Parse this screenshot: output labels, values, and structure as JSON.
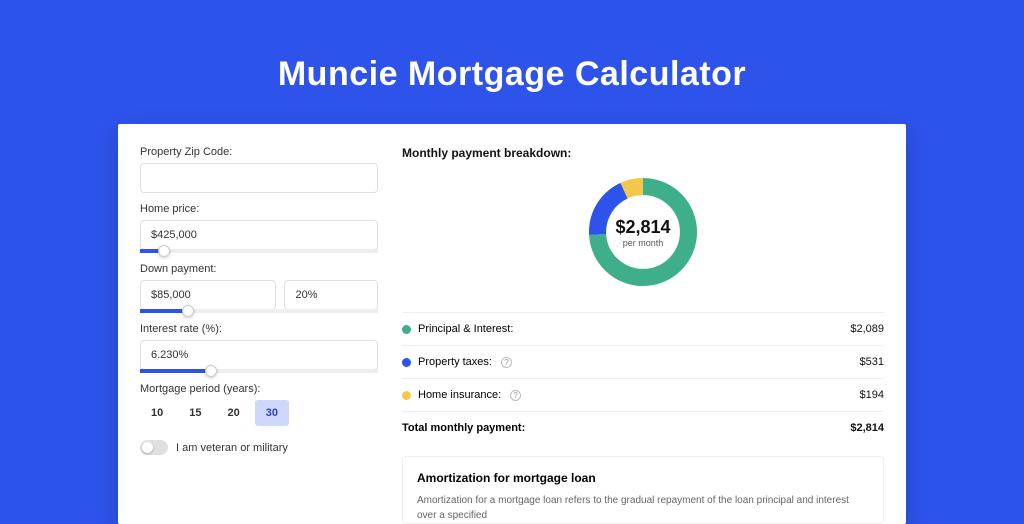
{
  "page_title": "Muncie Mortgage Calculator",
  "form": {
    "zip_label": "Property Zip Code:",
    "zip_value": "",
    "home_price_label": "Home price:",
    "home_price_value": "$425,000",
    "home_price_slider_pct": 10,
    "down_payment_label": "Down payment:",
    "down_payment_value": "$85,000",
    "down_payment_pct_value": "20%",
    "down_payment_slider_pct": 20,
    "interest_label": "Interest rate (%):",
    "interest_value": "6.230%",
    "interest_slider_pct": 30,
    "period_label": "Mortgage period (years):",
    "period_options": [
      "10",
      "15",
      "20",
      "30"
    ],
    "period_selected": "30",
    "veteran_label": "I am veteran or military"
  },
  "breakdown_title": "Monthly payment breakdown:",
  "donut": {
    "amount": "$2,814",
    "sub": "per month"
  },
  "legend": [
    {
      "color": "#3fae8b",
      "label": "Principal & Interest:",
      "value": "$2,089",
      "info": false
    },
    {
      "color": "#2e53eb",
      "label": "Property taxes:",
      "value": "$531",
      "info": true
    },
    {
      "color": "#f3c84a",
      "label": "Home insurance:",
      "value": "$194",
      "info": true
    }
  ],
  "total_row": {
    "label": "Total monthly payment:",
    "value": "$2,814"
  },
  "amortization": {
    "title": "Amortization for mortgage loan",
    "text": "Amortization for a mortgage loan refers to the gradual repayment of the loan principal and interest over a specified"
  },
  "chart_data": {
    "type": "pie",
    "title": "Monthly payment breakdown",
    "total": 2814,
    "unit": "USD",
    "series": [
      {
        "name": "Principal & Interest",
        "value": 2089,
        "color": "#3fae8b"
      },
      {
        "name": "Property taxes",
        "value": 531,
        "color": "#2e53eb"
      },
      {
        "name": "Home insurance",
        "value": 194,
        "color": "#f3c84a"
      }
    ]
  }
}
